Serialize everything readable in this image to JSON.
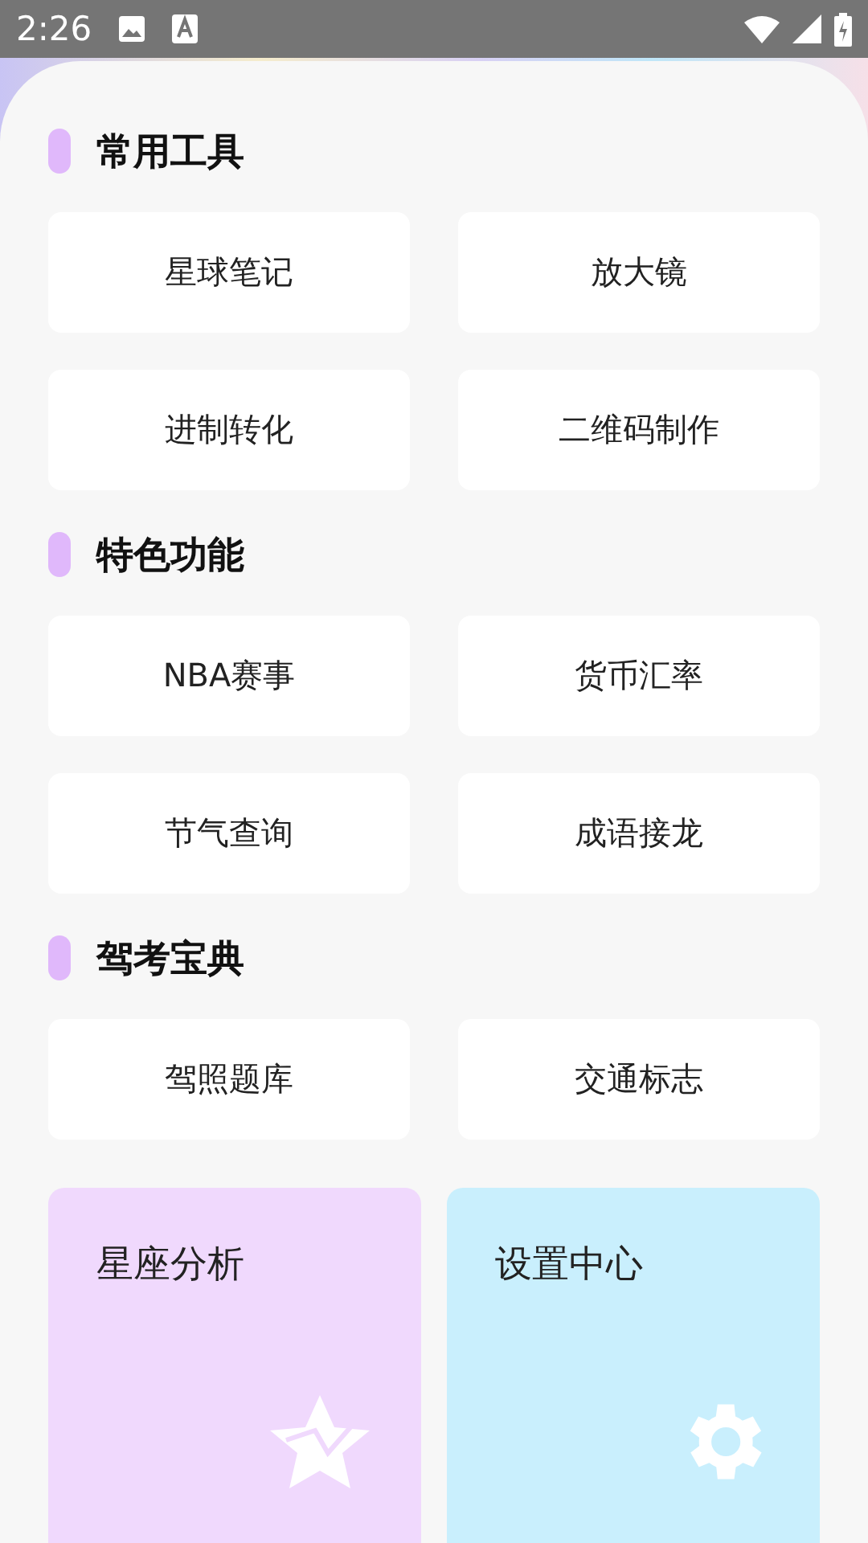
{
  "status_bar": {
    "time": "2:26"
  },
  "sections": [
    {
      "title": "常用工具",
      "items": [
        "星球笔记",
        "放大镜",
        "进制转化",
        "二维码制作"
      ]
    },
    {
      "title": "特色功能",
      "items": [
        "NBA赛事",
        "货币汇率",
        "节气查询",
        "成语接龙"
      ]
    },
    {
      "title": "驾考宝典",
      "items": [
        "驾照题库",
        "交通标志"
      ]
    }
  ],
  "cards": [
    {
      "title": "星座分析",
      "kind": "star",
      "color": "#f0d9fd"
    },
    {
      "title": "设置中心",
      "kind": "gear",
      "color": "#c9effd"
    }
  ]
}
